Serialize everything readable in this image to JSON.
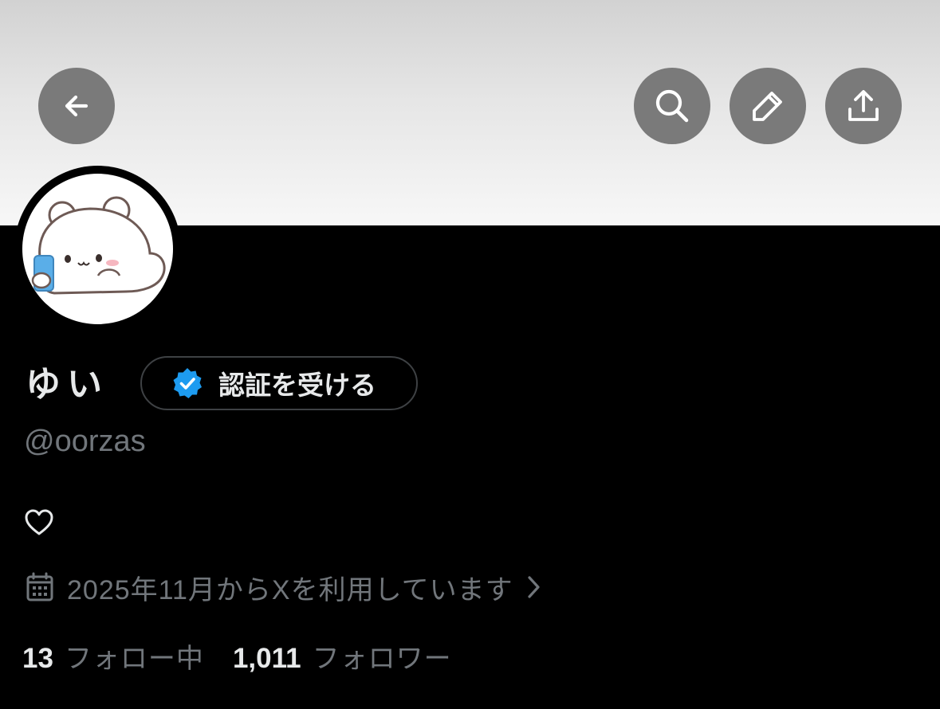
{
  "header": {
    "back_icon": "arrow-left-icon",
    "actions": [
      {
        "name": "search",
        "icon": "search-icon"
      },
      {
        "name": "edit",
        "icon": "pencil-icon"
      },
      {
        "name": "share",
        "icon": "upload-icon"
      }
    ]
  },
  "profile": {
    "display_name": "ゆい",
    "verify_label": "認証を受ける",
    "verify_icon": "verified-badge-icon",
    "handle": "@oorzas",
    "bio_icon": "heart-outline-icon",
    "joined_text": "2025年11月からXを利用しています",
    "joined_icon": "calendar-icon",
    "following_count": "13",
    "following_label": "フォロー中",
    "followers_count": "1,011",
    "followers_label": "フォロワー"
  },
  "colors": {
    "background": "#000000",
    "primary_text": "#e7e9ea",
    "secondary_text": "#71767b",
    "verified_blue": "#1d9bf0",
    "header_button": "#7a7a7a"
  }
}
